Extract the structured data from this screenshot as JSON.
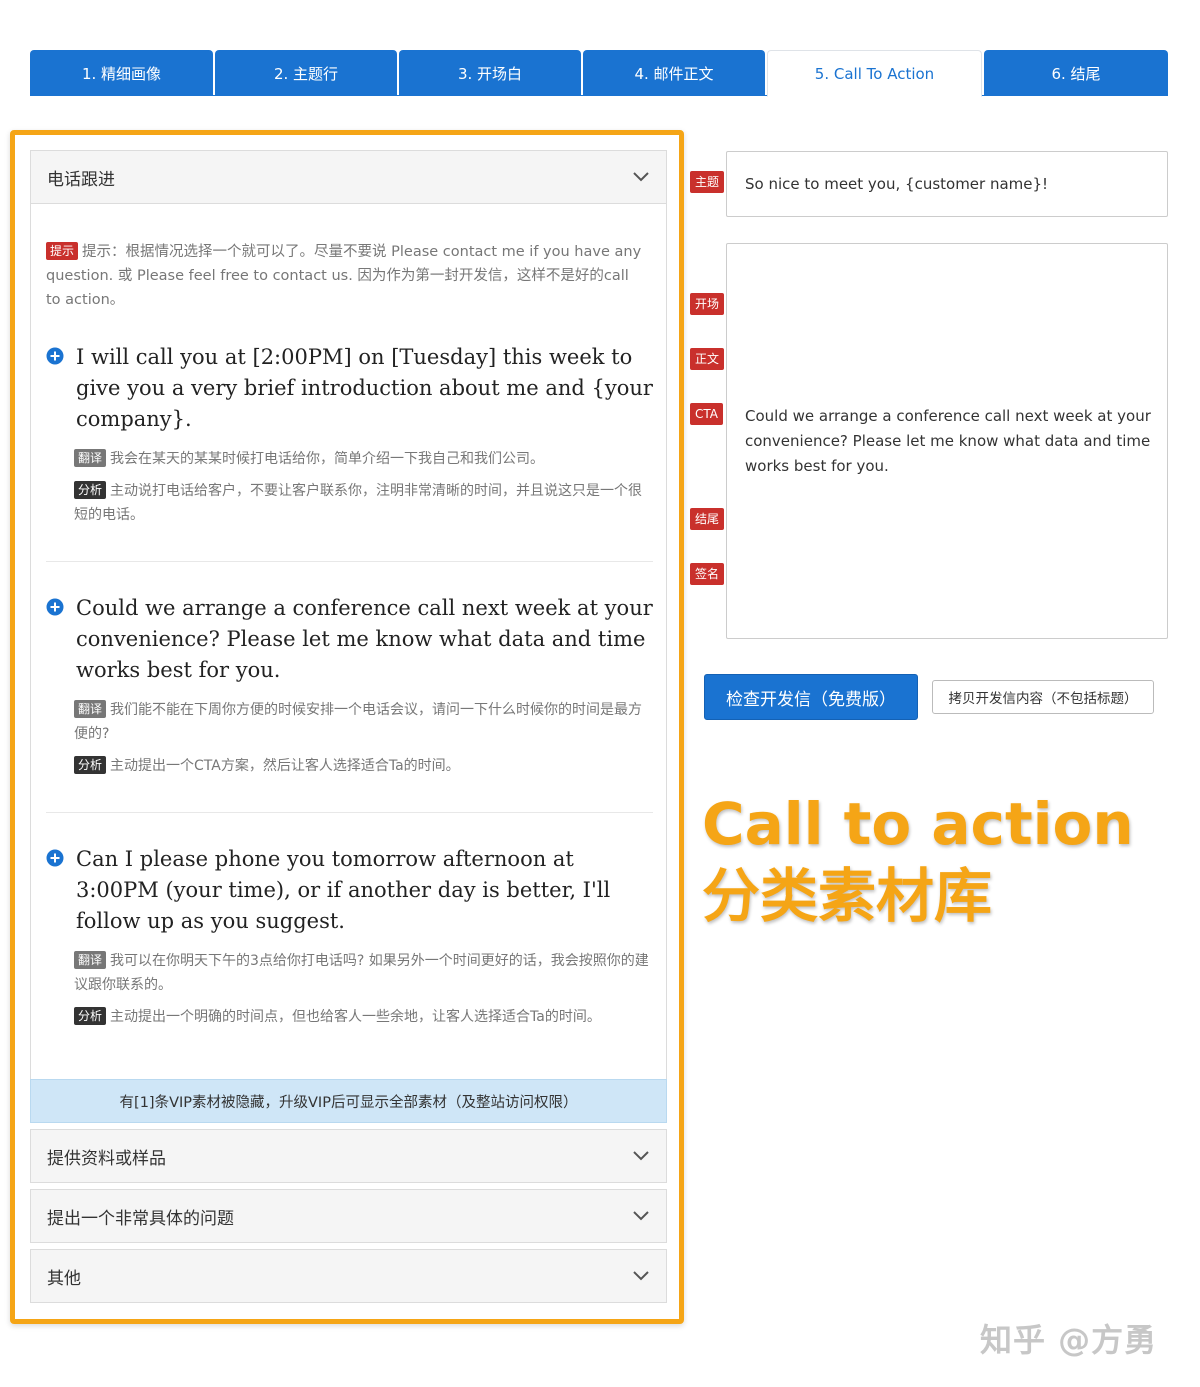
{
  "tabs": [
    {
      "label": "1. 精细画像"
    },
    {
      "label": "2. 主题行"
    },
    {
      "label": "3. 开场白"
    },
    {
      "label": "4. 邮件正文"
    },
    {
      "label": "5. Call To Action"
    },
    {
      "label": "6. 结尾"
    }
  ],
  "active_tab": "5. Call To Action",
  "accordion": {
    "open_section": "电话跟进",
    "hint_tag": "提示",
    "hint_text": "提示：根据情况选择一个就可以了。尽量不要说 Please contact me if you have any question. 或 Please feel free to contact us. 因为作为第一封开发信，这样不是好的call to action。",
    "translate_tag": "翻译",
    "analysis_tag": "分析",
    "items": [
      {
        "en": "I will call you at [2:00PM] on [Tuesday] this week to give you a very brief introduction about me and {your company}.",
        "translation": "我会在某天的某某时候打电话给你，简单介绍一下我自己和我们公司。",
        "analysis": "主动说打电话给客户，不要让客户联系你，注明非常清晰的时间，并且说这只是一个很短的电话。"
      },
      {
        "en": "Could we arrange a conference call next week at your convenience? Please let me know what data and time works best for you.",
        "translation": "我们能不能在下周你方便的时候安排一个电话会议，请问一下什么时候你的时间是最方便的?",
        "analysis": "主动提出一个CTA方案，然后让客人选择适合Ta的时间。"
      },
      {
        "en": "Can I please phone you tomorrow afternoon at 3:00PM (your time), or if another day is better, I'll follow up as you suggest.",
        "translation": "我可以在你明天下午的3点给你打电话吗? 如果另外一个时间更好的话，我会按照你的建议跟你联系的。",
        "analysis": "主动提出一个明确的时间点，但也给客人一些余地，让客人选择适合Ta的时间。"
      }
    ],
    "vip_note": "有[1]条VIP素材被隐藏，升级VIP后可显示全部素材（及整站访问权限）",
    "collapsed_sections": [
      "提供资料或样品",
      "提出一个非常具体的问题",
      "其他"
    ]
  },
  "email": {
    "labels": {
      "subject": "主题",
      "opening": "开场",
      "body": "正文",
      "cta": "CTA",
      "closing": "结尾",
      "signature": "签名"
    },
    "subject_value": "So nice to meet you, {customer name}!",
    "body_value": "Could we arrange a conference call next week at your convenience? Please let me know what data and time works best for you."
  },
  "buttons": {
    "check": "检查开发信（免费版）",
    "copy": "拷贝开发信内容（不包括标题）"
  },
  "annotation": {
    "line1": "Call to action",
    "line2": "分类素材库"
  },
  "watermark": "知乎 @方勇",
  "colors": {
    "primary": "#1a73d1",
    "highlight": "#f5a516",
    "tag_red": "#c9302c"
  },
  "icons": {
    "chevron": "chevron-down-icon",
    "plus": "plus-circle-icon"
  }
}
